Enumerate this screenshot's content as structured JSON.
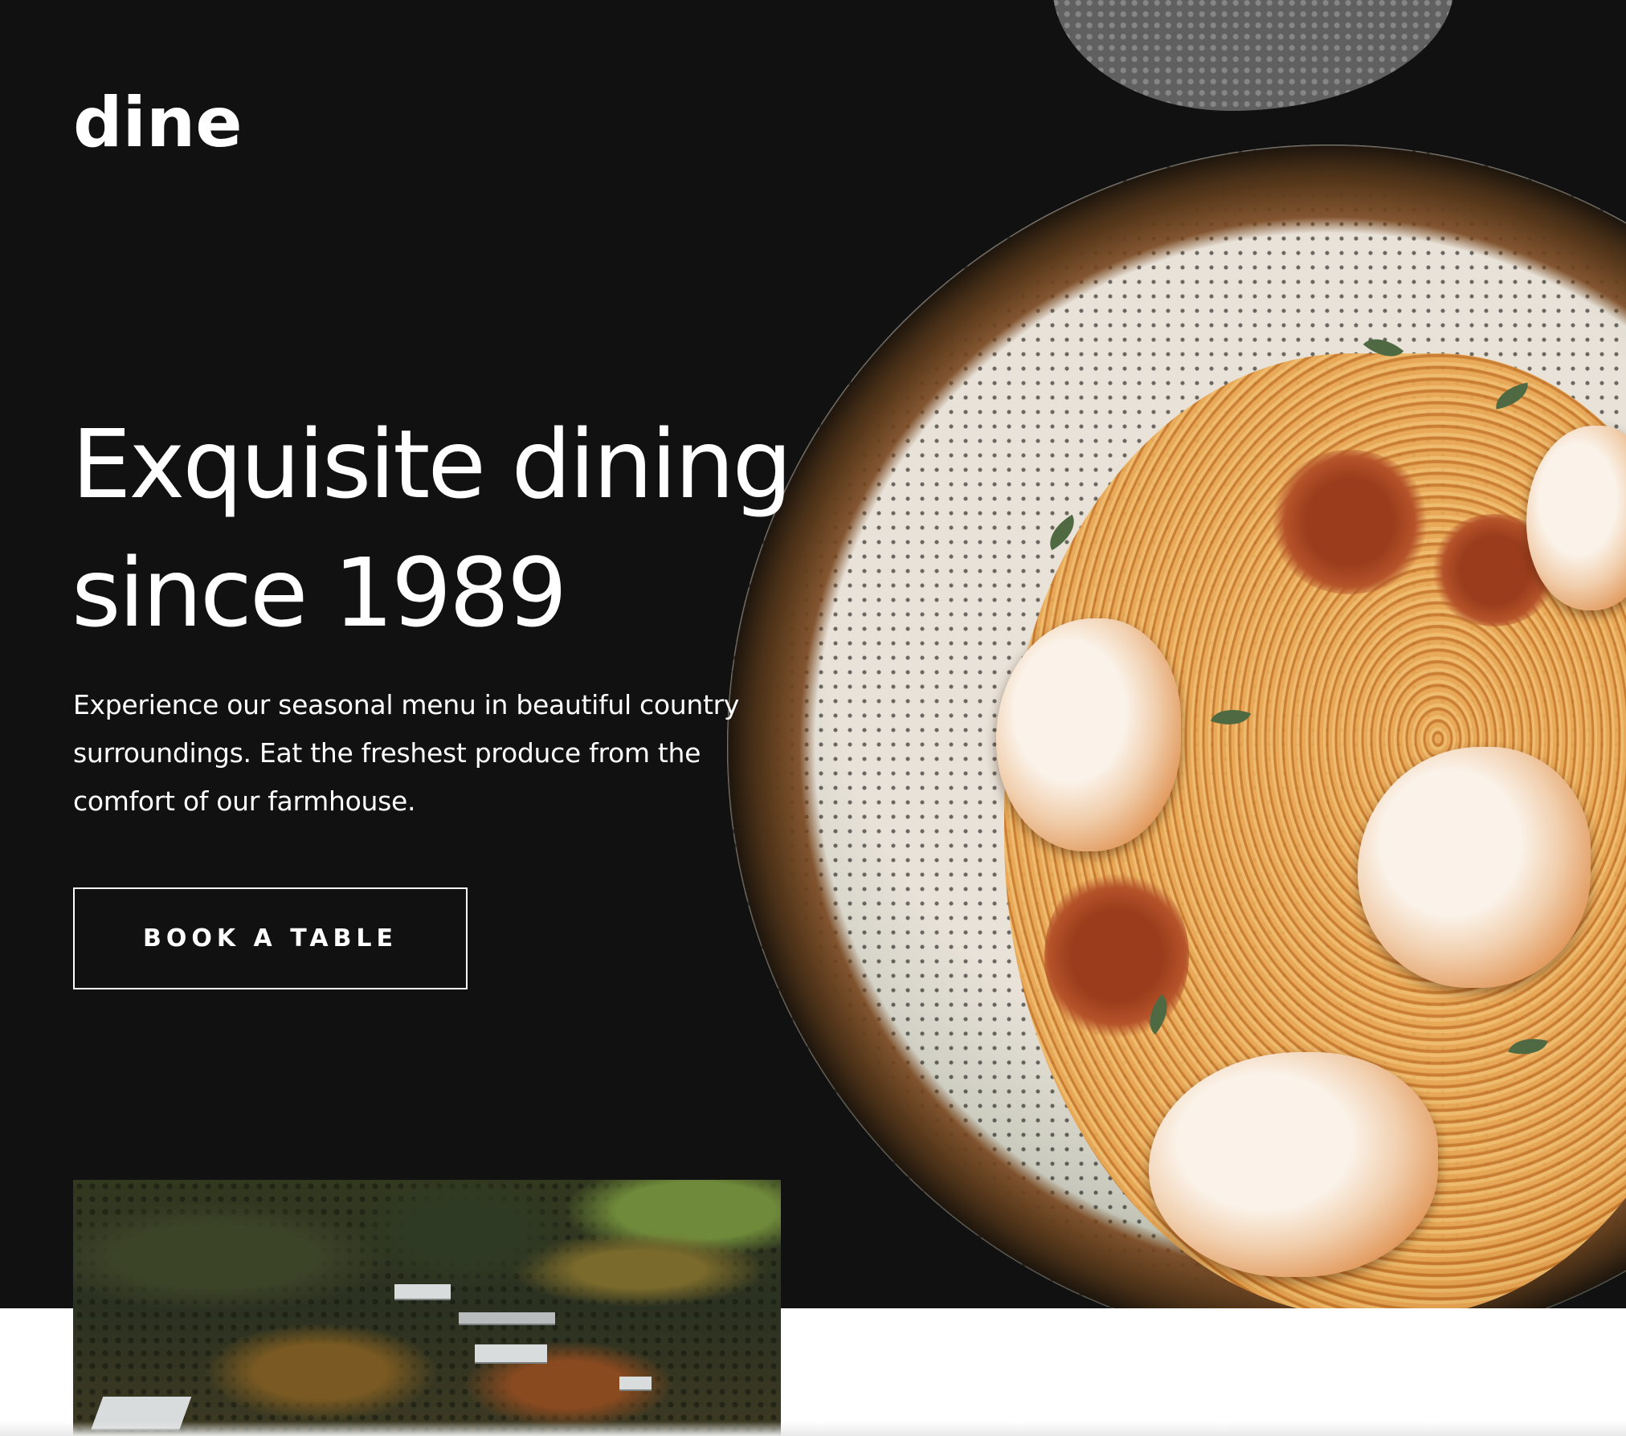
{
  "header": {
    "logo": "dine"
  },
  "hero": {
    "headline_line1": "Exquisite dining",
    "headline_line2": "since 1989",
    "intro": "Experience our seasonal menu in beautiful country surroundings. Eat the freshest produce from the comfort of our farmhouse.",
    "cta_label": "BOOK A TABLE"
  },
  "colors": {
    "hero_background": "#111112",
    "text": "#ffffff",
    "page_background": "#ffffff"
  }
}
